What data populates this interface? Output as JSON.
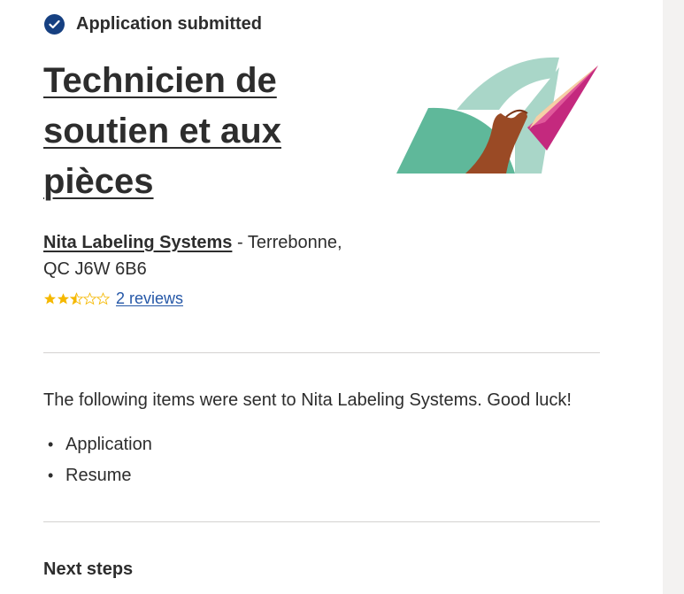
{
  "status": {
    "text": "Application submitted",
    "icon": "check-circle-icon"
  },
  "job": {
    "title": "Technicien de soutien et aux pièces",
    "company": "Nita Labeling Systems",
    "location_separator": " - ",
    "location": "Terrebonne, QC J6W 6B6"
  },
  "rating": {
    "value": 2.5,
    "max": 5,
    "reviews_label": "2 reviews",
    "star_color": "#f5b800"
  },
  "confirmation": {
    "sent_text": "The following items were sent to Nita Labeling Systems. Good luck!",
    "items": [
      "Application",
      "Resume"
    ],
    "bullet": "•"
  },
  "next_steps": {
    "heading": "Next steps"
  },
  "colors": {
    "accent": "#164081",
    "link": "#2557a7",
    "text": "#2d2d2d"
  }
}
